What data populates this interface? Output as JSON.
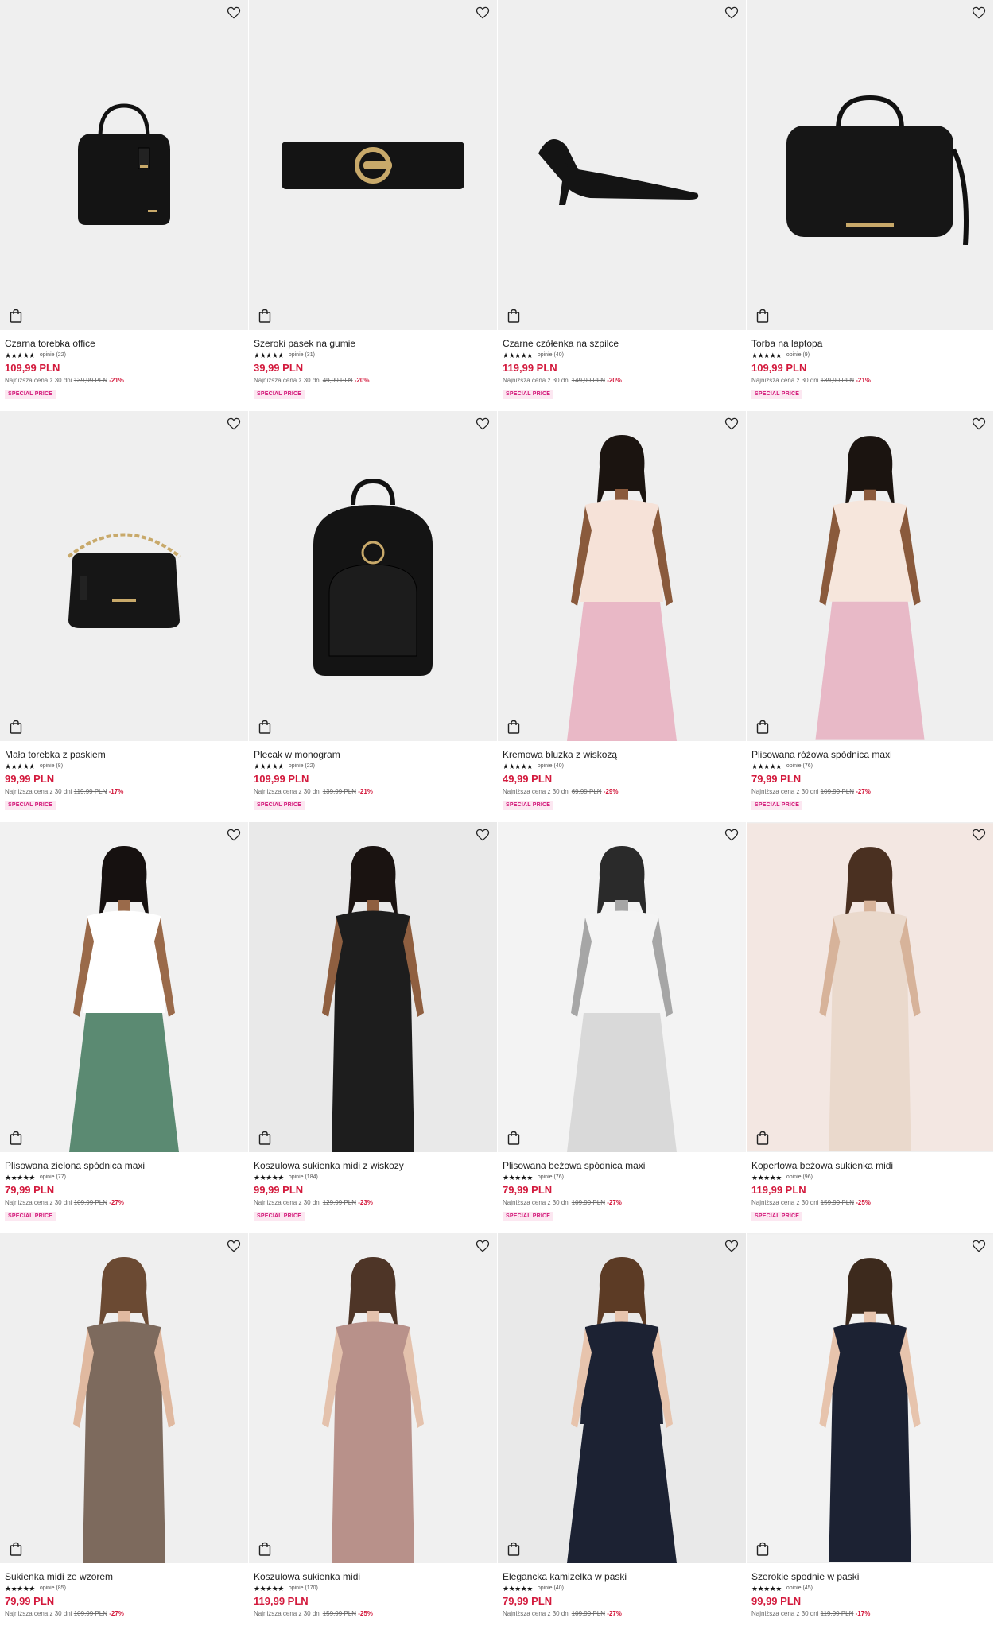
{
  "colors": {
    "price": "#d3193c",
    "badge_bg": "#fce7f1",
    "badge_text": "#d3197a"
  },
  "lowest_label": "Najniższa cena z 30 dni",
  "products": [
    {
      "title": "Czarna torebka office",
      "rating": 4.5,
      "reviews": "opinie (22)",
      "price": "109,99 PLN",
      "old_price": "139,99 PLN",
      "discount": "-21%",
      "badge": "SPECIAL PRICE",
      "image": "black-handbag",
      "bg": "grey"
    },
    {
      "title": "Szeroki pasek na gumie",
      "rating": 4.5,
      "reviews": "opinie (31)",
      "price": "39,99 PLN",
      "old_price": "49,99 PLN",
      "discount": "-20%",
      "badge": "SPECIAL PRICE",
      "image": "black-belt",
      "bg": "grey"
    },
    {
      "title": "Czarne czółenka na szpilce",
      "rating": 5,
      "reviews": "opinie (40)",
      "price": "119,99 PLN",
      "old_price": "149,99 PLN",
      "discount": "-20%",
      "badge": "SPECIAL PRICE",
      "image": "black-heel",
      "bg": "grey"
    },
    {
      "title": "Torba na laptopa",
      "rating": 5,
      "reviews": "opinie (9)",
      "price": "109,99 PLN",
      "old_price": "139,99 PLN",
      "discount": "-21%",
      "badge": "SPECIAL PRICE",
      "image": "laptop-bag",
      "bg": "grey"
    },
    {
      "title": "Mała torebka z paskiem",
      "rating": 5,
      "reviews": "opinie (8)",
      "price": "99,99 PLN",
      "old_price": "119,99 PLN",
      "discount": "-17%",
      "badge": "SPECIAL PRICE",
      "image": "small-bag",
      "bg": "grey"
    },
    {
      "title": "Plecak w monogram",
      "rating": 5,
      "reviews": "opinie (22)",
      "price": "109,99 PLN",
      "old_price": "139,99 PLN",
      "discount": "-21%",
      "badge": "SPECIAL PRICE",
      "image": "backpack",
      "bg": "grey"
    },
    {
      "title": "Kremowa bluzka z wiskozą",
      "rating": 4.5,
      "reviews": "opinie (40)",
      "price": "49,99 PLN",
      "old_price": "69,99 PLN",
      "discount": "-29%",
      "badge": "SPECIAL PRICE",
      "image": "model-cream-blouse",
      "bg": "grey"
    },
    {
      "title": "Plisowana różowa spódnica maxi",
      "rating": 5,
      "reviews": "opinie (76)",
      "price": "79,99 PLN",
      "old_price": "109,99 PLN",
      "discount": "-27%",
      "badge": "SPECIAL PRICE",
      "image": "model-pink-skirt",
      "bg": "grey"
    },
    {
      "title": "Plisowana zielona spódnica maxi",
      "rating": 5,
      "reviews": "opinie (77)",
      "price": "79,99 PLN",
      "old_price": "109,99 PLN",
      "discount": "-27%",
      "badge": "SPECIAL PRICE",
      "image": "model-green-skirt",
      "bg": "grey"
    },
    {
      "title": "Koszulowa sukienka midi z wiskozy",
      "rating": 5,
      "reviews": "opinie (184)",
      "price": "99,99 PLN",
      "old_price": "129,99 PLN",
      "discount": "-23%",
      "badge": "SPECIAL PRICE",
      "image": "model-floral-dress",
      "bg": "grey"
    },
    {
      "title": "Plisowana beżowa spódnica maxi",
      "rating": 5,
      "reviews": "opinie (76)",
      "price": "79,99 PLN",
      "old_price": "109,99 PLN",
      "discount": "-27%",
      "badge": "SPECIAL PRICE",
      "image": "model-beige-skirt",
      "bg": "grey"
    },
    {
      "title": "Kopertowa beżowa sukienka midi",
      "rating": 4.5,
      "reviews": "opinie (96)",
      "price": "119,99 PLN",
      "old_price": "159,99 PLN",
      "discount": "-25%",
      "badge": "SPECIAL PRICE",
      "image": "model-beige-dress",
      "bg": "grey"
    },
    {
      "title": "Sukienka midi ze wzorem",
      "rating": 5,
      "reviews": "opinie (85)",
      "price": "79,99 PLN",
      "old_price": "109,99 PLN",
      "discount": "-27%",
      "badge": "",
      "image": "model-pattern-dress",
      "bg": "grey"
    },
    {
      "title": "Koszulowa sukienka midi",
      "rating": 4.5,
      "reviews": "opinie (170)",
      "price": "119,99 PLN",
      "old_price": "159,99 PLN",
      "discount": "-25%",
      "badge": "",
      "image": "model-rose-dress",
      "bg": "grey"
    },
    {
      "title": "Elegancka kamizelka w paski",
      "rating": 5,
      "reviews": "opinie (40)",
      "price": "79,99 PLN",
      "old_price": "109,99 PLN",
      "discount": "-27%",
      "badge": "",
      "image": "model-vest",
      "bg": "grey"
    },
    {
      "title": "Szerokie spodnie w paski",
      "rating": 5,
      "reviews": "opinie (45)",
      "price": "99,99 PLN",
      "old_price": "119,99 PLN",
      "discount": "-17%",
      "badge": "",
      "image": "model-trousers",
      "bg": "grey"
    }
  ]
}
